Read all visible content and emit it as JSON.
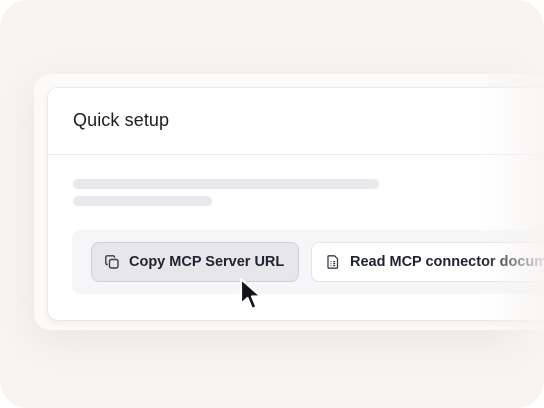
{
  "card": {
    "title": "Quick setup"
  },
  "buttons": {
    "copy_label": "Copy MCP Server URL",
    "read_label": "Read MCP connector documentation"
  },
  "icons": {
    "copy": "copy-icon",
    "document": "document-icon",
    "cursor": "mouse-pointer"
  },
  "colors": {
    "frame_bg": "#f7f4f2",
    "card_bg": "#ffffff",
    "action_strip_bg": "#f6f6f9",
    "copy_button_bg": "#e6e6eb",
    "text": "#1f2230"
  }
}
